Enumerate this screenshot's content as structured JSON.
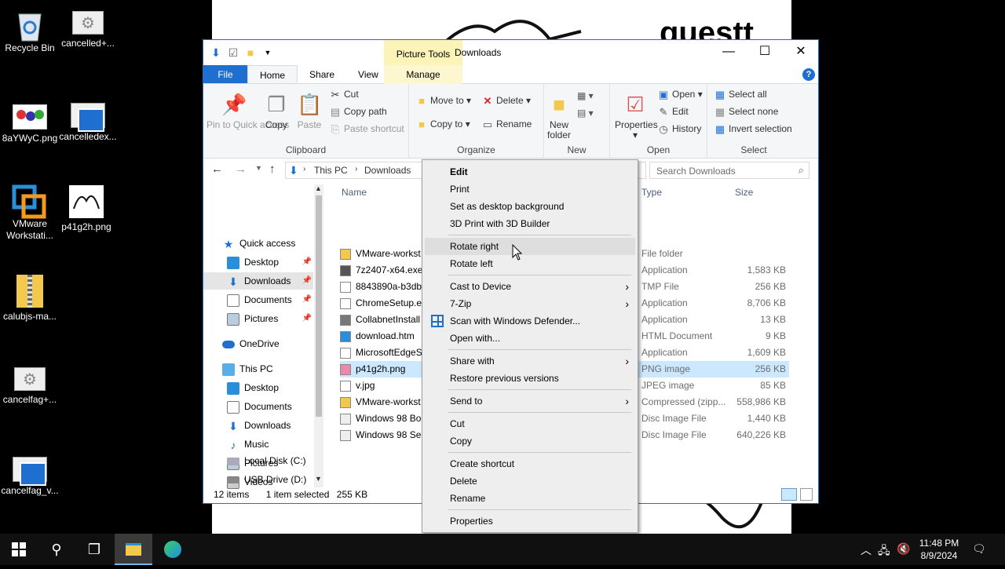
{
  "desktop": {
    "icons": [
      {
        "label": "Recycle Bin",
        "icon": "recycle-bin-icon"
      },
      {
        "label": "cancelled+...",
        "icon": "settings-image-icon"
      },
      {
        "label": "8aYWyC.png",
        "icon": "image-thumbnail-icon"
      },
      {
        "label": "cancelledex...",
        "icon": "document-icon"
      },
      {
        "label": "VMware Workstati...",
        "icon": "vmware-icon"
      },
      {
        "label": "p41g2h.png",
        "icon": "image-thumbnail-icon"
      },
      {
        "label": "calubjs-ma...",
        "icon": "zip-folder-icon"
      },
      {
        "label": "cancelfag+...",
        "icon": "settings-image-icon"
      },
      {
        "label": "cancelfag_v...",
        "icon": "document-icon"
      }
    ],
    "background_text": "guestt"
  },
  "window": {
    "contextual_tab": "Picture Tools",
    "title": "Downloads",
    "tabs": {
      "file": "File",
      "home": "Home",
      "share": "Share",
      "view": "View",
      "manage": "Manage"
    },
    "ribbon": {
      "clipboard": {
        "label": "Clipboard",
        "pin": "Pin to Quick access",
        "copy": "Copy",
        "paste": "Paste",
        "cut": "Cut",
        "copy_path": "Copy path",
        "paste_shortcut": "Paste shortcut"
      },
      "organize": {
        "label": "Organize",
        "move_to": "Move to",
        "copy_to": "Copy to",
        "delete": "Delete",
        "rename": "Rename"
      },
      "new": {
        "label": "New",
        "new_folder": "New folder"
      },
      "open": {
        "label": "Open",
        "properties": "Properties",
        "open": "Open",
        "edit": "Edit",
        "history": "History"
      },
      "select": {
        "label": "Select",
        "select_all": "Select all",
        "select_none": "Select none",
        "invert": "Invert selection"
      }
    },
    "address": {
      "crumb1": "This PC",
      "crumb2": "Downloads",
      "search_placeholder": "Search Downloads"
    },
    "nav": {
      "quick_access": "Quick access",
      "qa_items": [
        "Desktop",
        "Downloads",
        "Documents",
        "Pictures"
      ],
      "onedrive": "OneDrive",
      "this_pc": "This PC",
      "pc_items": [
        "Desktop",
        "Documents",
        "Downloads",
        "Music",
        "Pictures",
        "Videos",
        "Local Disk (C:)",
        "USB Drive (D:)"
      ]
    },
    "columns": {
      "name": "Name",
      "type": "Type",
      "size": "Size"
    },
    "files": [
      {
        "name": "VMware-workst",
        "type": "File folder",
        "size": ""
      },
      {
        "name": "7z2407-x64.exe",
        "type": "Application",
        "size": "1,583 KB"
      },
      {
        "name": "8843890a-b3db",
        "type": "TMP File",
        "size": "256 KB"
      },
      {
        "name": "ChromeSetup.e",
        "type": "Application",
        "size": "8,706 KB"
      },
      {
        "name": "CollabnetInstall",
        "type": "Application",
        "size": "13 KB"
      },
      {
        "name": "download.htm",
        "type": "HTML Document",
        "size": "9 KB"
      },
      {
        "name": "MicrosoftEdgeS",
        "type": "Application",
        "size": "1,609 KB"
      },
      {
        "name": "p41g2h.png",
        "type": "PNG image",
        "size": "256 KB"
      },
      {
        "name": "v.jpg",
        "type": "JPEG image",
        "size": "85 KB"
      },
      {
        "name": "VMware-workst",
        "type": "Compressed (zipp...",
        "size": "558,986 KB"
      },
      {
        "name": "Windows 98 Bo",
        "type": "Disc Image File",
        "size": "1,440 KB"
      },
      {
        "name": "Windows 98 Se",
        "type": "Disc Image File",
        "size": "640,226 KB"
      }
    ],
    "status": {
      "count": "12 items",
      "selected": "1 item selected",
      "size": "255 KB"
    }
  },
  "context_menu": {
    "items": [
      "Edit",
      "Print",
      "Set as desktop background",
      "3D Print with 3D Builder",
      "Rotate right",
      "Rotate left",
      "Cast to Device",
      "7-Zip",
      "Scan with Windows Defender...",
      "Open with...",
      "Share with",
      "Restore previous versions",
      "Send to",
      "Cut",
      "Copy",
      "Create shortcut",
      "Delete",
      "Rename",
      "Properties"
    ]
  },
  "taskbar": {
    "time": "11:48 PM",
    "date": "8/9/2024"
  }
}
